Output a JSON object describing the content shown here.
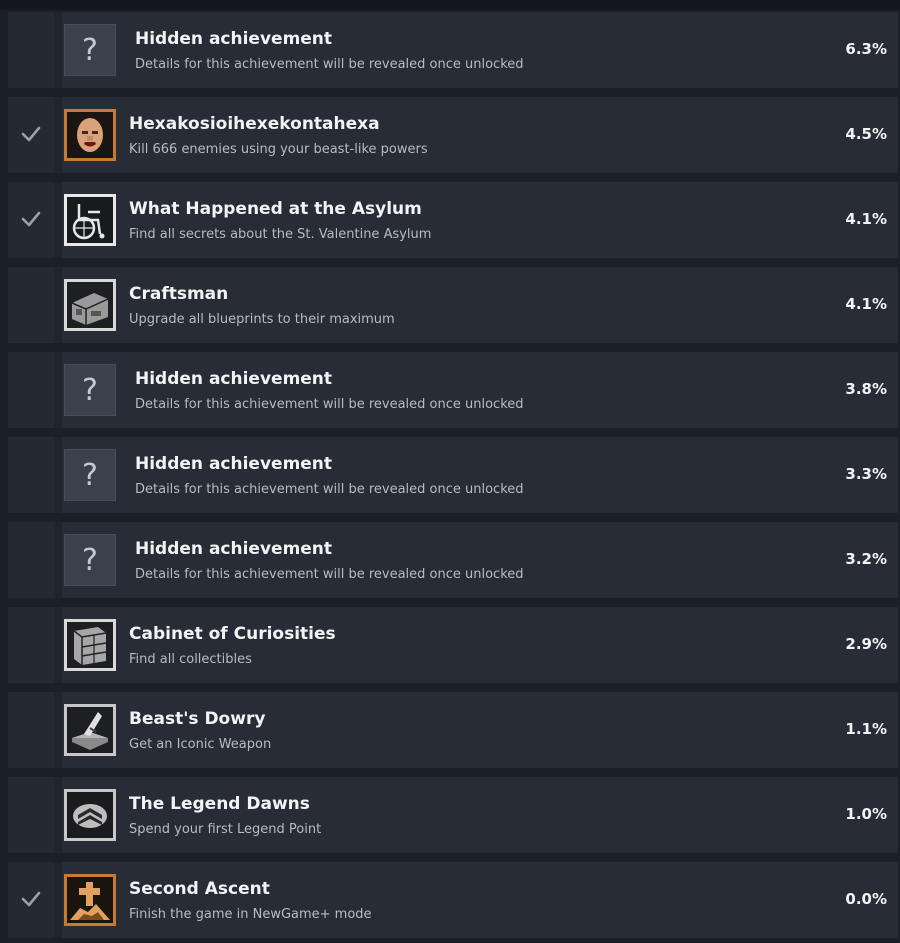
{
  "achievements": [
    {
      "kind": "hidden",
      "unlocked": false,
      "icon": "question-mark-icon",
      "title": "Hidden achievement",
      "description": "Details for this achievement will be revealed once unlocked",
      "percent": "6.3%",
      "glyph": "?"
    },
    {
      "kind": "normal",
      "unlocked": true,
      "icon": "bald-face-icon",
      "title": "Hexakosioihexekontahexa",
      "description": "Kill 666 enemies using your beast-like powers",
      "percent": "4.5%"
    },
    {
      "kind": "normal",
      "unlocked": true,
      "icon": "wheelchair-icon",
      "title": "What Happened at the Asylum",
      "description": "Find all secrets about the St. Valentine Asylum",
      "percent": "4.1%"
    },
    {
      "kind": "normal",
      "unlocked": false,
      "icon": "workbench-icon",
      "title": "Craftsman",
      "description": "Upgrade all blueprints to their maximum",
      "percent": "4.1%"
    },
    {
      "kind": "hidden",
      "unlocked": false,
      "icon": "question-mark-icon",
      "title": "Hidden achievement",
      "description": "Details for this achievement will be revealed once unlocked",
      "percent": "3.8%",
      "glyph": "?"
    },
    {
      "kind": "hidden",
      "unlocked": false,
      "icon": "question-mark-icon",
      "title": "Hidden achievement",
      "description": "Details for this achievement will be revealed once unlocked",
      "percent": "3.3%",
      "glyph": "?"
    },
    {
      "kind": "hidden",
      "unlocked": false,
      "icon": "question-mark-icon",
      "title": "Hidden achievement",
      "description": "Details for this achievement will be revealed once unlocked",
      "percent": "3.2%",
      "glyph": "?"
    },
    {
      "kind": "normal",
      "unlocked": false,
      "icon": "cabinet-icon",
      "title": "Cabinet of Curiosities",
      "description": "Find all collectibles",
      "percent": "2.9%"
    },
    {
      "kind": "normal",
      "unlocked": false,
      "icon": "weapon-chest-icon",
      "title": "Beast's Dowry",
      "description": "Get an Iconic Weapon",
      "percent": "1.1%"
    },
    {
      "kind": "normal",
      "unlocked": false,
      "icon": "rank-chevron-icon",
      "title": "The Legend Dawns",
      "description": "Spend your first Legend Point",
      "percent": "1.0%"
    },
    {
      "kind": "normal",
      "unlocked": true,
      "icon": "grave-cross-icon",
      "title": "Second Ascent",
      "description": "Finish the game in NewGame+ mode",
      "percent": "0.0%"
    }
  ],
  "colors": {
    "background": "#1b1f27",
    "row": "#272c36",
    "title": "#f1f3f5",
    "description": "#b7bcc4",
    "check": "#9aa1ab",
    "icon_gold": "#d0883a"
  }
}
